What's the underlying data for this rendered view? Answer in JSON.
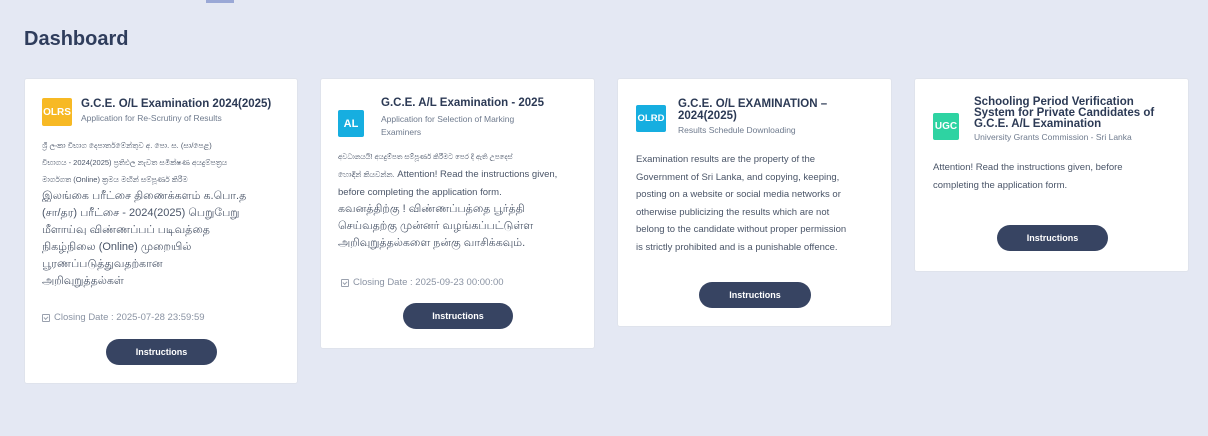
{
  "page": {
    "title": "Dashboard"
  },
  "cards": [
    {
      "badge": "OLRS",
      "badge_color": "#f7b924",
      "title": "G.C.E. O/L Examination 2024(2025)",
      "subtitle": "Application for Re-Scrutiny of Results",
      "body_si": [
        "ශ්‍රී ලංකා විභාග දෙපාර්තමේන්තුව අ. පො. ස. (සා/පෙළ)",
        "විභාගය - 2024(2025) ප්‍රතිඵල නැවත සමීක්ෂණ අයදුම්පත්‍රය",
        "මාර්ගගත (Online) ක්‍රමය මඟින් සම්පූර්ණ කිරීම"
      ],
      "body_ta": [
        "இலங்கை பரீட்சை திணைக்களம் க.பொ.த",
        "(சா/தர) பரீட்சை - 2024(2025) பெறுபேறு",
        "மீளாய்வு விண்ணப்பப் படிவத்தை",
        "நிகழ்நிலை (Online) முறையில்",
        "பூரணப்படுத்துவதற்கான",
        "அறிவுறுத்தல்கள்"
      ],
      "closing": "Closing Date : 2025-07-28 23:59:59",
      "button": "Instructions"
    },
    {
      "badge": "AL",
      "badge_color": "#16aee0",
      "title": "G.C.E. A/L Examination - 2025",
      "subtitle_lines": [
        "Application for Selection of Marking",
        "Examiners"
      ],
      "body_mixed_si": "අවධානයයි! අයදුම්පත සම්පූර්ණ කිරීමට පෙර දී ඇති උපදෙස්",
      "body_mixed_si2": "හොඳින් කියවන්න.",
      "body_en": "Attention! Read the instructions given, before completing the application form.",
      "body_ta": [
        "கவனத்திற்கு ! விண்ணப்பத்தை பூர்த்தி",
        "செய்வதற்கு முன்னர் வழங்கப்பட்டுள்ள",
        "அறிவுறுத்தல்களை நன்கு வாசிக்கவும்."
      ],
      "closing": "Closing Date : 2025-09-23 00:00:00",
      "button": "Instructions"
    },
    {
      "badge": "OLRD",
      "badge_color": "#16aee0",
      "title_lines": [
        "G.C.E. O/L EXAMINATION –",
        "2024(2025)"
      ],
      "subtitle": "Results Schedule Downloading",
      "body_lines": [
        "Examination results are the property of the",
        "Government of Sri Lanka, and copying, keeping,",
        "posting on a website or social media networks or",
        "otherwise publicizing the results which are not",
        "belong to the candidate without proper permission",
        "is strictly prohibited and is a punishable offence."
      ],
      "button": "Instructions"
    },
    {
      "badge": "UGC",
      "badge_color": "#2ed3a2",
      "title_lines": [
        "Schooling Period Verification",
        "System for Private Candidates of",
        "G.C.E. A/L Examination"
      ],
      "subtitle": "University Grants Commission - Sri Lanka",
      "body_lines": [
        "Attention! Read the instructions given, before",
        "completing the application form."
      ],
      "button": "Instructions"
    }
  ]
}
